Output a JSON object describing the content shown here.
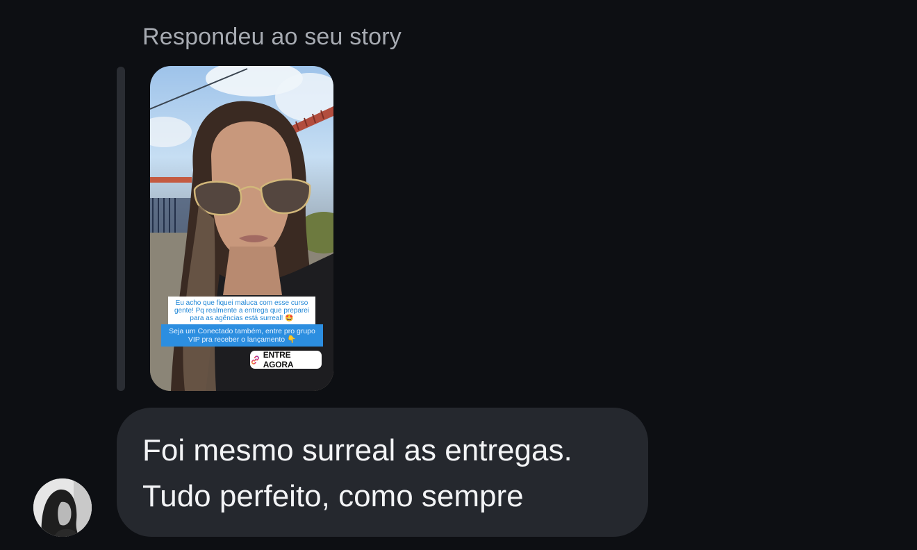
{
  "conversation": {
    "reply_header": "Respondeu ao seu story"
  },
  "story": {
    "caption": "Eu acho que fiquei maluca com esse curso gente! Pq realmente a entrega que preparei para as agências está surreal! 🤩",
    "cta_text": "Seja um Conectado também, entre pro grupo VIP pra receber o lançamento 👇",
    "link_sticker": {
      "icon": "link-icon",
      "label": "ENTRE AGORA"
    }
  },
  "message": {
    "lines": [
      "Foi mesmo surreal as entregas.",
      "Tudo perfeito, como sempre"
    ]
  },
  "sender": {
    "avatar": "avatar"
  },
  "colors": {
    "background": "#0d0f13",
    "bubble": "#25282e",
    "header_text": "#a7abb2",
    "message_text": "#f3f4f6",
    "caption_blue": "#1f86d6",
    "cta_blue": "#2c8ee0"
  }
}
